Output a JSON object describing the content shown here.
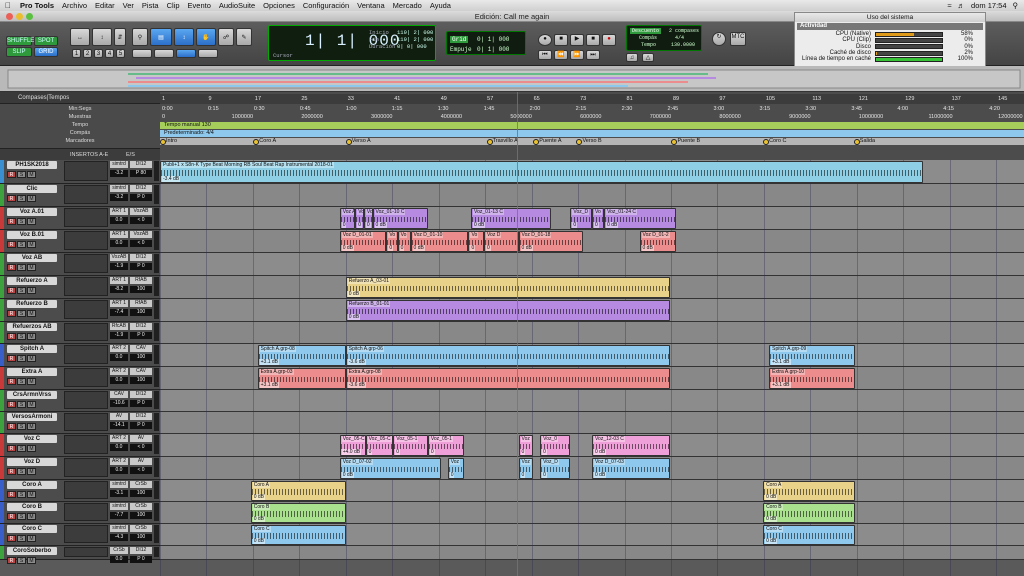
{
  "menubar": {
    "app": "Pro Tools",
    "items": [
      "Archivo",
      "Editar",
      "Ver",
      "Pista",
      "Clip",
      "Evento",
      "AudioSuite",
      "Opciones",
      "Configuración",
      "Ventana",
      "Mercado",
      "Ayuda"
    ],
    "clock": "dom 17:54"
  },
  "window": {
    "title": "Edición: Call me again"
  },
  "toolbar": {
    "modes": [
      "SHUFFLE",
      "SPOT",
      "SLIP",
      "GRID"
    ],
    "zoom_presets": [
      "1",
      "2",
      "3",
      "4",
      "5"
    ],
    "counter_main": "1| 1| 000",
    "counter_start_label": "Inicio",
    "counter_start": "119| 2| 000",
    "counter_end_label": "Fin",
    "counter_end": "119| 2| 000",
    "counter_dur_label": "Duración",
    "counter_dur": "0| 0| 000",
    "cursor_label": "Cursor",
    "grid_label": "Grid",
    "grid_value": "0| 1| 000",
    "nudge_label": "Empuje",
    "nudge_value": "0| 1| 000",
    "countoff_label": "Descuento",
    "countoff_value": "2 compases",
    "meter_label": "Compás",
    "meter_value": "4/4",
    "tempo_label": "Tempo",
    "tempo_value": "130.0000"
  },
  "usage": {
    "title": "Uso del sistema",
    "section": "Actividad",
    "rows": [
      {
        "label": "CPU (Native)",
        "pct": "58%",
        "fill": 0.58
      },
      {
        "label": "CPU (Clip)",
        "pct": "0%",
        "fill": 0
      },
      {
        "label": "Disco",
        "pct": "0%",
        "fill": 0
      },
      {
        "label": "Caché de disco",
        "pct": "2%",
        "fill": 0.02
      },
      {
        "label": "Línea de tiempo en caché",
        "pct": "100%",
        "fill": 1
      }
    ]
  },
  "rulers": {
    "labels": [
      "Compases|Tempos",
      "Min:Segs",
      "Muestras",
      "Tempo",
      "Compás",
      "Marcadores"
    ],
    "bars": [
      "1",
      "9",
      "17",
      "25",
      "33",
      "41",
      "49",
      "57",
      "65",
      "73",
      "81",
      "89",
      "97",
      "105",
      "113",
      "121",
      "129",
      "137",
      "145"
    ],
    "minsecs": [
      "0:00",
      "0:15",
      "0:30",
      "0:45",
      "1:00",
      "1:15",
      "1:30",
      "1:45",
      "2:00",
      "2:15",
      "2:30",
      "2:45",
      "3:00",
      "3:15",
      "3:30",
      "3:45",
      "4:00",
      "4:15",
      "4:20"
    ],
    "samples": [
      "0",
      "1000000",
      "2000000",
      "3000000",
      "4000000",
      "5000000",
      "6000000",
      "7000000",
      "8000000",
      "9000000",
      "10000000",
      "11000000",
      "12000000"
    ],
    "tempo_text": "Tempo manual  130",
    "meter_text": "Predeterminado: 4/4",
    "markers": [
      {
        "name": "Intro",
        "pos": 0.0
      },
      {
        "name": "Coro A",
        "pos": 0.108
      },
      {
        "name": "Verso A",
        "pos": 0.215
      },
      {
        "name": "Trasvillo A",
        "pos": 0.378
      },
      {
        "name": "Puente A",
        "pos": 0.432
      },
      {
        "name": "Verso B",
        "pos": 0.482
      },
      {
        "name": "Puente B",
        "pos": 0.592
      },
      {
        "name": "Coro C",
        "pos": 0.698
      },
      {
        "name": "Salida",
        "pos": 0.803
      }
    ]
  },
  "tracks_header": {
    "inserts": "INSERTOS A-E",
    "io": "E/S"
  },
  "tracks": [
    {
      "name": "PH1SK2018",
      "color": "#3a8fd0",
      "in": "simtrd",
      "out": "DI12",
      "vol": "-3.2",
      "pan": "P 80",
      "h": 24
    },
    {
      "name": "Clic",
      "color": "#3da23d",
      "in": "simtrd",
      "out": "DI12",
      "vol": "-3.2",
      "pan": "P 0",
      "h": 23
    },
    {
      "name": "Voz A.01",
      "color": "#c83a3a",
      "in": "ART 1",
      "out": "VozAB",
      "vol": "0.0",
      "pan": "< 0",
      "h": 23
    },
    {
      "name": "Voz B.01",
      "color": "#c83a3a",
      "in": "ART 1",
      "out": "VozAB",
      "vol": "0.0",
      "pan": "< 0",
      "h": 23
    },
    {
      "name": "Voz AB",
      "color": "#3da23d",
      "in": "VozAB",
      "out": "DI12",
      "vol": "-1.9",
      "pan": "P 0",
      "h": 23
    },
    {
      "name": "Refuerzo A",
      "color": "#3da23d",
      "in": "ART 1",
      "out": "RfAB",
      "vol": "-8.2",
      "pan": "100",
      "h": 23
    },
    {
      "name": "Refuerzo B",
      "color": "#3da23d",
      "in": "ART 1",
      "out": "RfAB",
      "vol": "-7.4",
      "pan": "100",
      "h": 23
    },
    {
      "name": "Refuerzos AB",
      "color": "#3da23d",
      "in": "RfcAB",
      "out": "DI12",
      "vol": "-1.9",
      "pan": "P 0",
      "h": 22
    },
    {
      "name": "Spitch A",
      "color": "#3a5ec8",
      "in": "ART 2",
      "out": "CAV",
      "vol": "0.0",
      "pan": "100",
      "h": 23
    },
    {
      "name": "Extra A",
      "color": "#c83a3a",
      "in": "ART 2",
      "out": "CAV",
      "vol": "0.0",
      "pan": "100",
      "h": 23
    },
    {
      "name": "CrsArmnVrss",
      "color": "#3da23d",
      "in": "CAV",
      "out": "DI12",
      "vol": "-10.6",
      "pan": "P 0",
      "h": 22
    },
    {
      "name": "VersosArmoni",
      "color": "#3da23d",
      "in": "AV",
      "out": "DI12",
      "vol": "-14.1",
      "pan": "P 0",
      "h": 22
    },
    {
      "name": "Voz C",
      "color": "#c83a3a",
      "in": "ART 2",
      "out": "AV",
      "vol": "0.0",
      "pan": "< 0",
      "h": 23
    },
    {
      "name": "Voz D",
      "color": "#c83a3a",
      "in": "ART 2",
      "out": "AV",
      "vol": "0.0",
      "pan": "< 0",
      "h": 23
    },
    {
      "name": "Coro A",
      "color": "#3a5ec8",
      "in": "simtrd",
      "out": "CrSb",
      "vol": "-3.1",
      "pan": "100",
      "h": 22
    },
    {
      "name": "Coro B",
      "color": "#3a5ec8",
      "in": "simtrd",
      "out": "CrSb",
      "vol": "-7.7",
      "pan": "100",
      "h": 22
    },
    {
      "name": "Coro C",
      "color": "#3a5ec8",
      "in": "simtrd",
      "out": "CrSb",
      "vol": "-4.3",
      "pan": "100",
      "h": 22
    },
    {
      "name": "CoroSoberbo",
      "color": "#3da23d",
      "in": "CrSb",
      "out": "DI12",
      "vol": "0.0",
      "pan": "P 0",
      "h": 14
    }
  ],
  "clips": [
    {
      "track": 0,
      "name": "Publi+1 x S8n-K Type Beat Morning RB Soul Beat Rap Instrumental 2018-01",
      "start": 0.0,
      "end": 0.883,
      "color": "#8ecfe6",
      "gain": "-3.4 dB"
    },
    {
      "track": 2,
      "name": "Voz A",
      "start": 0.208,
      "end": 0.226,
      "color": "#b58ae0",
      "gain": "0"
    },
    {
      "track": 2,
      "name": "Voz",
      "start": 0.226,
      "end": 0.236,
      "color": "#b58ae0",
      "gain": "0"
    },
    {
      "track": 2,
      "name": "Vo",
      "start": 0.236,
      "end": 0.246,
      "color": "#b58ae0",
      "gain": "0"
    },
    {
      "track": 2,
      "name": "Voz_01-10 C",
      "start": 0.246,
      "end": 0.31,
      "color": "#b58ae0",
      "gain": "0 dB"
    },
    {
      "track": 2,
      "name": "Voz_01-13 C",
      "start": 0.36,
      "end": 0.453,
      "color": "#b58ae0",
      "gain": "0 dB"
    },
    {
      "track": 2,
      "name": "Voz_D",
      "start": 0.475,
      "end": 0.5,
      "color": "#b58ae0",
      "gain": "0"
    },
    {
      "track": 2,
      "name": "Vo",
      "start": 0.5,
      "end": 0.514,
      "color": "#b58ae0",
      "gain": "0"
    },
    {
      "track": 2,
      "name": "Voz_01-24 C",
      "start": 0.514,
      "end": 0.597,
      "color": "#b58ae0",
      "gain": "0 dB"
    },
    {
      "track": 3,
      "name": "Voz D_01-01",
      "start": 0.208,
      "end": 0.262,
      "color": "#ec8c8c",
      "gain": "0 dB"
    },
    {
      "track": 3,
      "name": "Vo",
      "start": 0.262,
      "end": 0.275,
      "color": "#ec8c8c",
      "gain": "0"
    },
    {
      "track": 3,
      "name": "Vo",
      "start": 0.275,
      "end": 0.29,
      "color": "#ec8c8c",
      "gain": "0"
    },
    {
      "track": 3,
      "name": "Voz D_01-10",
      "start": 0.29,
      "end": 0.357,
      "color": "#ec8c8c",
      "gain": "0 dB"
    },
    {
      "track": 3,
      "name": "Vo",
      "start": 0.357,
      "end": 0.375,
      "color": "#ec8c8c",
      "gain": "0"
    },
    {
      "track": 3,
      "name": "Voz D",
      "start": 0.375,
      "end": 0.415,
      "color": "#ec8c8c",
      "gain": "0"
    },
    {
      "track": 3,
      "name": "Voz D_01-18",
      "start": 0.415,
      "end": 0.49,
      "color": "#ec8c8c",
      "gain": "0 dB"
    },
    {
      "track": 3,
      "name": "Voz D_01-2",
      "start": 0.555,
      "end": 0.597,
      "color": "#ec8c8c",
      "gain": "0 dB"
    },
    {
      "track": 5,
      "name": "Refuerzo A_03-01",
      "start": 0.215,
      "end": 0.59,
      "color": "#e8d28a",
      "gain": "0 dB"
    },
    {
      "track": 6,
      "name": "Refuerzo B_01-01",
      "start": 0.215,
      "end": 0.59,
      "color": "#b58ae0",
      "gain": "0 dB"
    },
    {
      "track": 8,
      "name": "Spitch A.grp-08",
      "start": 0.113,
      "end": 0.215,
      "color": "#8ec8ec",
      "gain": "+3.1 dB"
    },
    {
      "track": 8,
      "name": "Spitch A.grp-06",
      "start": 0.215,
      "end": 0.59,
      "color": "#8ec8ec",
      "gain": "-3.6 dB"
    },
    {
      "track": 8,
      "name": "Spitch A.grp-09",
      "start": 0.705,
      "end": 0.804,
      "color": "#8ec8ec",
      "gain": "+3.1 dB"
    },
    {
      "track": 9,
      "name": "Extra A.grp-03",
      "start": 0.113,
      "end": 0.215,
      "color": "#ec8c8c",
      "gain": "+3.1 dB"
    },
    {
      "track": 9,
      "name": "Extra A.grp-08",
      "start": 0.215,
      "end": 0.59,
      "color": "#ec8c8c",
      "gain": "-3.6 dB"
    },
    {
      "track": 9,
      "name": "Extra A.grp-10",
      "start": 0.705,
      "end": 0.804,
      "color": "#ec8c8c",
      "gain": "+3.1 dB"
    },
    {
      "track": 12,
      "name": "Voz_05-C",
      "start": 0.208,
      "end": 0.238,
      "color": "#f0a0d8",
      "gain": "+4.0 dB"
    },
    {
      "track": 12,
      "name": "Voz_05-C",
      "start": 0.238,
      "end": 0.27,
      "color": "#f0a0d8",
      "gain": "0"
    },
    {
      "track": 12,
      "name": "Voz_05-1",
      "start": 0.27,
      "end": 0.31,
      "color": "#f0a0d8",
      "gain": "0"
    },
    {
      "track": 12,
      "name": "Voz_05-1",
      "start": 0.31,
      "end": 0.352,
      "color": "#f0a0d8",
      "gain": "0"
    },
    {
      "track": 12,
      "name": "Voz",
      "start": 0.415,
      "end": 0.432,
      "color": "#f0a0d8",
      "gain": "0"
    },
    {
      "track": 12,
      "name": "Voz_0",
      "start": 0.44,
      "end": 0.475,
      "color": "#f0a0d8",
      "gain": "0"
    },
    {
      "track": 12,
      "name": "Voz_12-03 C",
      "start": 0.5,
      "end": 0.59,
      "color": "#f0a0d8",
      "gain": "0 dB"
    },
    {
      "track": 13,
      "name": "Voz D_07-02",
      "start": 0.208,
      "end": 0.325,
      "color": "#8ec8ec",
      "gain": "0 dB"
    },
    {
      "track": 13,
      "name": "Voz",
      "start": 0.333,
      "end": 0.352,
      "color": "#8ec8ec",
      "gain": "0"
    },
    {
      "track": 13,
      "name": "Voz",
      "start": 0.415,
      "end": 0.432,
      "color": "#8ec8ec",
      "gain": "0"
    },
    {
      "track": 13,
      "name": "Voz_D",
      "start": 0.44,
      "end": 0.475,
      "color": "#8ec8ec",
      "gain": "0"
    },
    {
      "track": 13,
      "name": "Voz D_07-03",
      "start": 0.5,
      "end": 0.59,
      "color": "#8ec8ec",
      "gain": "0 dB"
    },
    {
      "track": 14,
      "name": "Coro A",
      "start": 0.105,
      "end": 0.215,
      "color": "#e8d28a",
      "gain": "0 dB"
    },
    {
      "track": 14,
      "name": "Coro A",
      "start": 0.698,
      "end": 0.804,
      "color": "#e8d28a",
      "gain": "0 dB"
    },
    {
      "track": 15,
      "name": "Coro B",
      "start": 0.105,
      "end": 0.215,
      "color": "#a8e08e",
      "gain": "0 dB"
    },
    {
      "track": 15,
      "name": "Coro B",
      "start": 0.698,
      "end": 0.804,
      "color": "#a8e08e",
      "gain": "0 dB"
    },
    {
      "track": 16,
      "name": "Coro C",
      "start": 0.105,
      "end": 0.215,
      "color": "#8ec8ec",
      "gain": "0 dB"
    },
    {
      "track": 16,
      "name": "Coro C",
      "start": 0.698,
      "end": 0.804,
      "color": "#8ec8ec",
      "gain": "0 dB"
    }
  ]
}
